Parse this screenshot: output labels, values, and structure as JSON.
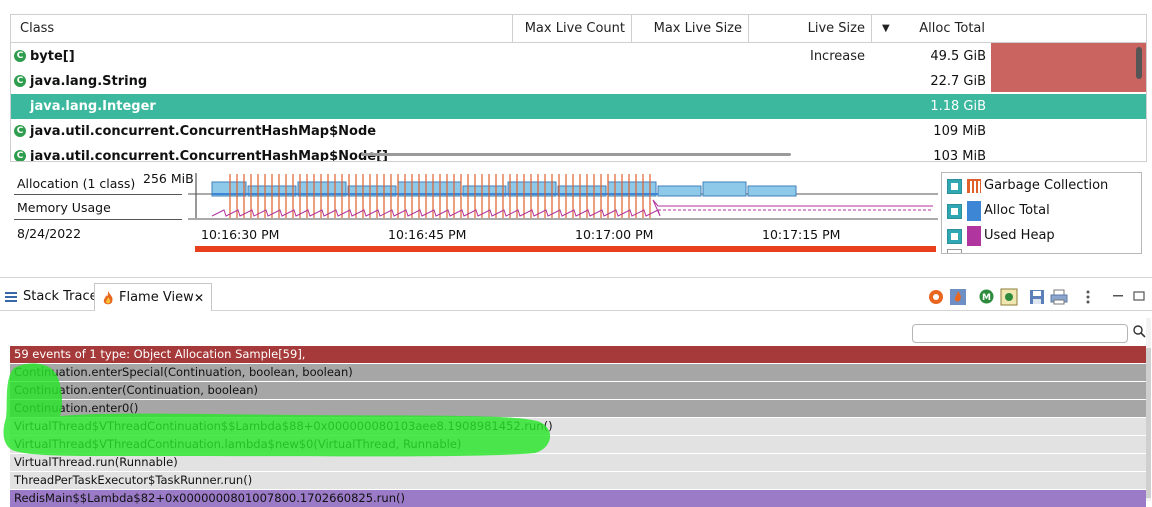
{
  "table": {
    "columns": [
      "Class",
      "Max Live Count",
      "Max Live Size",
      "Live Size Increase",
      "Alloc Total"
    ],
    "sort_indicator": "▼",
    "rows": [
      {
        "name": "byte[]",
        "alloc_total": "49.5 GiB"
      },
      {
        "name": "java.lang.String",
        "alloc_total": "22.7 GiB"
      },
      {
        "name": "java.lang.Integer",
        "alloc_total": "1.18 GiB"
      },
      {
        "name": "java.util.concurrent.ConcurrentHashMap$Node",
        "alloc_total": "109 MiB"
      },
      {
        "name": "java.util.concurrent.ConcurrentHashMap$Node[]",
        "alloc_total": "103 MiB"
      }
    ],
    "selected_index": 2,
    "bar_color": "#c96461",
    "selected_color": "#3bb89e"
  },
  "timeline": {
    "rows": [
      "Allocation (1 class)",
      "Memory Usage"
    ],
    "date": "8/24/2022",
    "y_max_label": "256 MiB",
    "time_ticks": [
      "10:16:30 PM",
      "10:16:45 PM",
      "10:17:00 PM",
      "10:17:15 PM"
    ],
    "legend": [
      {
        "label": "Garbage Collection",
        "color": "#e0602b"
      },
      {
        "label": "Alloc Total",
        "color": "#3d86d6"
      },
      {
        "label": "Used Heap",
        "color": "#b0359e"
      }
    ]
  },
  "tabs": [
    {
      "label": "Stack Trace",
      "icon": "list-icon"
    },
    {
      "label": "Flame View",
      "icon": "flame-icon",
      "active": true,
      "close": "✕"
    }
  ],
  "toolbar": {
    "icons": [
      "flame-settings-icon",
      "flame-filter-icon",
      "module-icon",
      "package-icon",
      "save-icon",
      "print-icon",
      "view-menu-icon",
      "minimize-icon",
      "maximize-icon"
    ]
  },
  "search": {
    "placeholder": "",
    "icon": "search-icon"
  },
  "flame": {
    "rows": [
      {
        "text": "59 events of 1 type: Object Allocation Sample[59],",
        "style": "root"
      },
      {
        "text": "Continuation.enterSpecial(Continuation, boolean, boolean)",
        "style": "grey"
      },
      {
        "text": "Continuation.enter(Continuation, boolean)",
        "style": "grey"
      },
      {
        "text": "Continuation.enter0()",
        "style": "grey"
      },
      {
        "text": "VirtualThread$VThreadContinuation$$Lambda$88+0x000000080103aee8.1908981452.run()",
        "style": "light"
      },
      {
        "text": "VirtualThread$VThreadContinuation.lambda$new$0(VirtualThread, Runnable)",
        "style": "light"
      },
      {
        "text": "VirtualThread.run(Runnable)",
        "style": "light"
      },
      {
        "text": "ThreadPerTaskExecutor$TaskRunner.run()",
        "style": "light"
      },
      {
        "text": "RedisMain$$Lambda$82+0x0000000801007800.1702660825.run()",
        "style": "purple"
      }
    ]
  }
}
